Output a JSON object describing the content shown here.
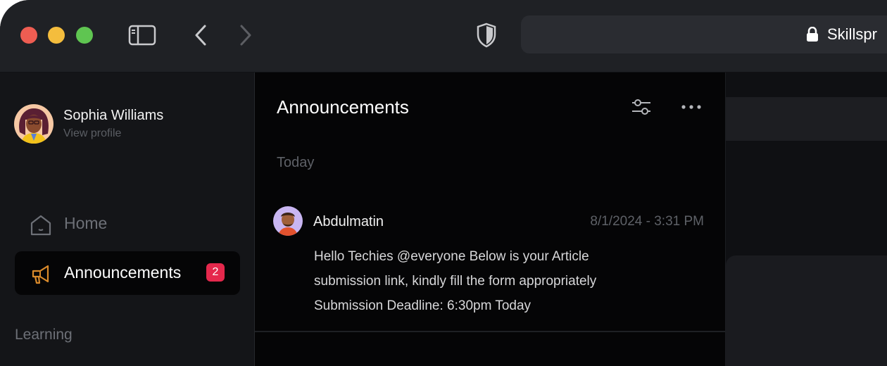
{
  "browser": {
    "url": "Skillspr",
    "colors": {
      "close": "#ee5d52",
      "minimize": "#f4bd3d",
      "zoom": "#5fc551"
    },
    "icons": [
      "sidebar-toggle-icon",
      "back-arrow-icon",
      "forward-arrow-icon",
      "shield-icon",
      "lock-icon"
    ]
  },
  "profile": {
    "name": "Sophia Williams",
    "link": "View profile"
  },
  "nav": {
    "items": [
      {
        "label": "Home",
        "icon": "home-icon"
      },
      {
        "label": "Announcements",
        "icon": "megaphone-icon",
        "badge": "2",
        "active": true
      }
    ],
    "section": "Learning"
  },
  "panel": {
    "title": "Announcements",
    "actions": [
      "filter-sliders-icon",
      "more-options-icon"
    ],
    "day": "Today",
    "message": {
      "author": "Abdulmatin",
      "time": "8/1/2024 - 3:31 PM",
      "lines": [
        "Hello Techies @everyone   Below is your Article",
        "submission link, kindly fill the form appropriately",
        "Submission Deadline: 6:30pm Today"
      ]
    }
  },
  "theme": {
    "accent": "#e5284c",
    "icon_accent": "#d98a2b"
  }
}
